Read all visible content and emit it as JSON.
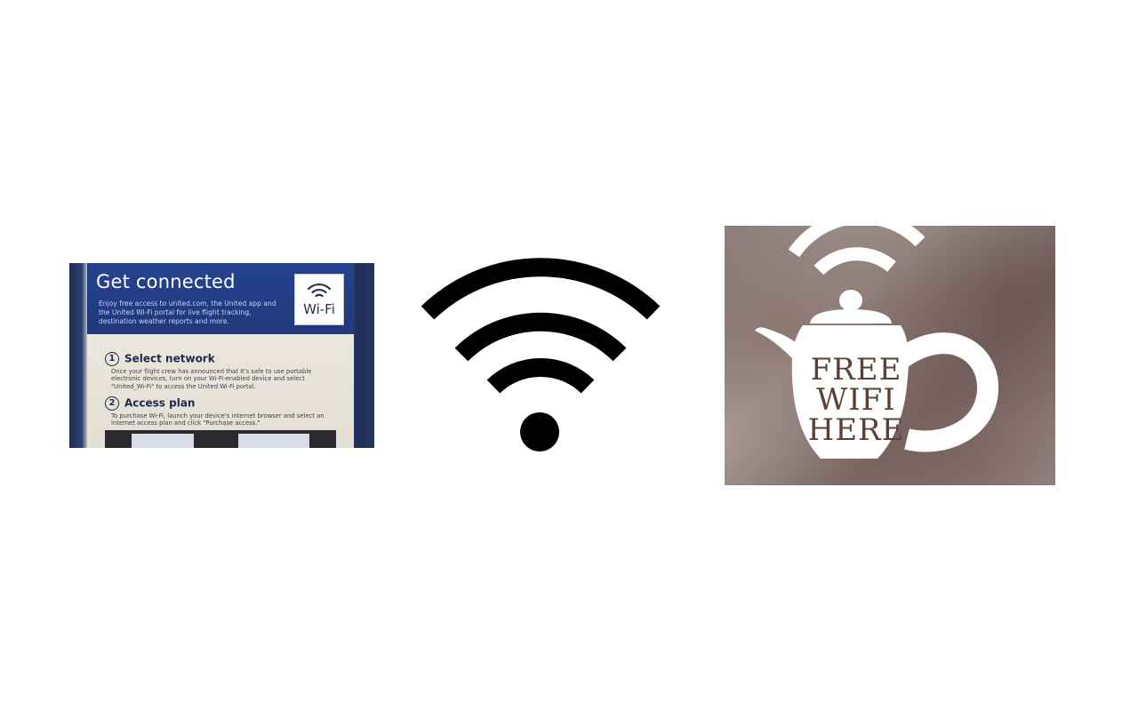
{
  "left_photo": {
    "title": "Get connected",
    "intro": "Enjoy free access to united.com, the United app and the United Wi-Fi portal for live flight tracking, destination weather reports and more.",
    "badge_label": "Wi-Fi",
    "steps": [
      {
        "number": "1",
        "heading": "Select network",
        "text": "Once your flight crew has announced that it's safe to use portable electronic devices, turn on your Wi-Fi-enabled device and select \"United_Wi-Fi\" to access the United Wi-Fi portal."
      },
      {
        "number": "2",
        "heading": "Access plan",
        "text": "To purchase Wi-Fi, launch your device's internet browser and select an internet access plan and click \"Purchase access.\""
      }
    ]
  },
  "center_icon": {
    "name": "wifi-icon",
    "color": "#000000"
  },
  "right_photo": {
    "sign_lines": [
      "FREE",
      "WIFI",
      "HERE"
    ],
    "sticker_color": "#ffffff",
    "text_color": "#5a4036"
  }
}
